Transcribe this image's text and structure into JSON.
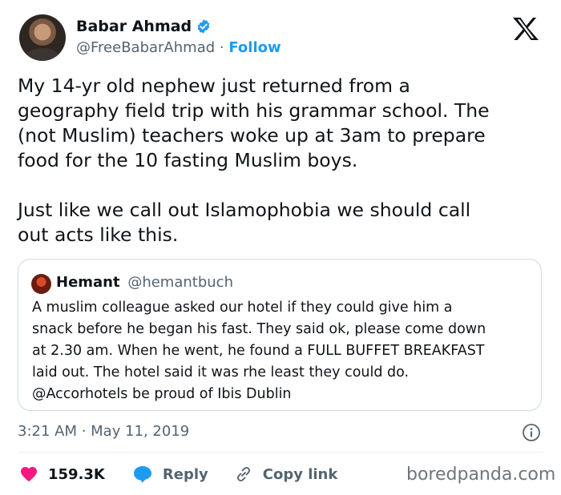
{
  "author": {
    "name": "Babar Ahmad",
    "handle": "@FreeBabarAhmad",
    "separator": "·",
    "follow_label": "Follow"
  },
  "tweet": {
    "text": "My 14-yr old nephew just returned from a\ngeography field trip with his grammar school. The\n(not Muslim) teachers woke up at 3am to prepare\nfood for the 10 fasting Muslim boys.\n\nJust like we call out Islamophobia we should call\nout acts like this."
  },
  "quote": {
    "name": "Hemant",
    "handle": "@hemantbuch",
    "text": "A muslim colleague asked our hotel if they could give him a\nsnack before he began his fast. They said ok, please come down\nat 2.30 am. When he went, he found a FULL BUFFET BREAKFAST\nlaid out. The hotel said it was rhe least they could do.\n@Accorhotels be proud of Ibis Dublin"
  },
  "timestamp": "3:21 AM · May 11, 2019",
  "actions": {
    "likes": "159.3K",
    "reply": "Reply",
    "copy_link": "Copy link"
  },
  "watermark": "boredpanda.com",
  "icons": [
    "verified-icon",
    "x-logo-icon",
    "info-icon",
    "heart-icon",
    "reply-icon",
    "link-icon"
  ],
  "colors": {
    "accent": "#1d9bf0",
    "like": "#f91880",
    "muted": "#536471",
    "text": "#0f1419"
  }
}
